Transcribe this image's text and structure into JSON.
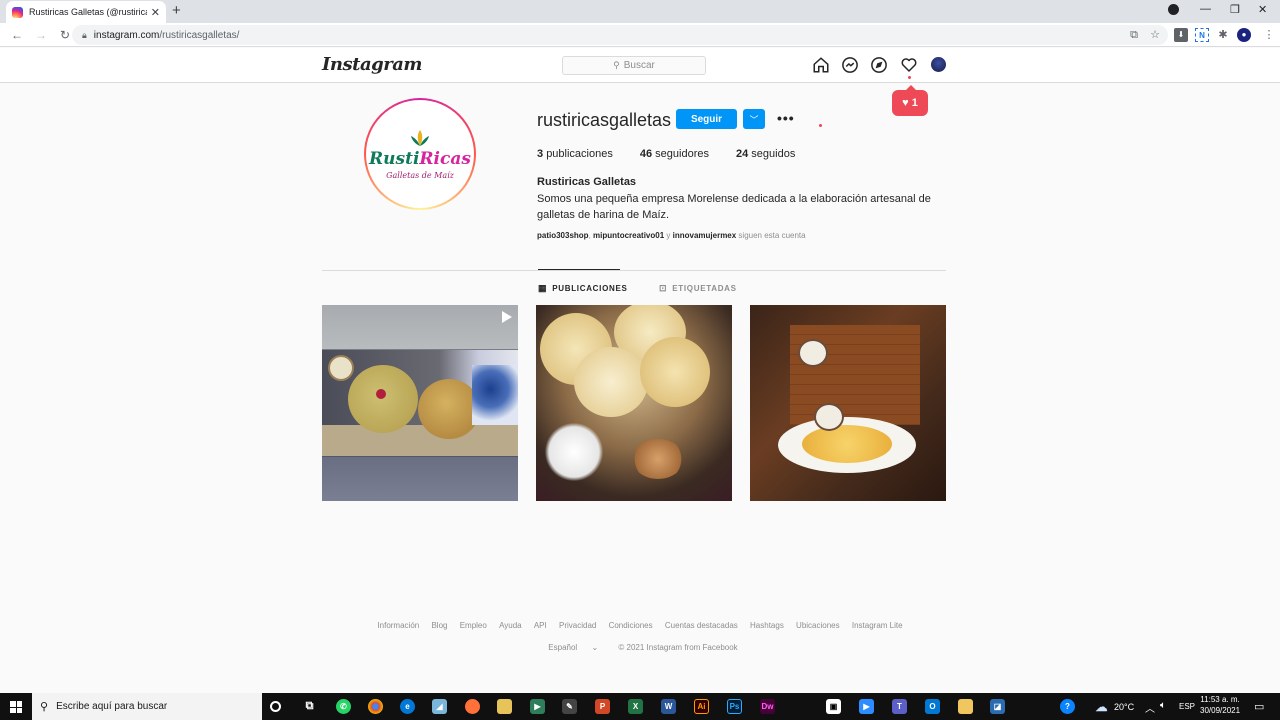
{
  "browser": {
    "tab_title": "Rustiricas Galletas (@rustiricasga",
    "tab_close": "✕",
    "new_tab": "+",
    "url_host": "instagram.com",
    "url_path": "/rustiricasgalletas/"
  },
  "instagram": {
    "logo": "Instagram",
    "search_placeholder": "Buscar",
    "notification_count": "1",
    "profile": {
      "logo_part1": "Rusti",
      "logo_part2": "Ricas",
      "logo_sub": "Galletas de Maíz",
      "username": "rustiricasgalletas",
      "follow_label": "Seguir",
      "more_label": "•••",
      "stats": {
        "posts_count": "3",
        "posts_label": "publicaciones",
        "followers_count": "46",
        "followers_label": "seguidores",
        "following_count": "24",
        "following_label": "seguidos"
      },
      "full_name": "Rustiricas Galletas",
      "bio": "Somos una pequeña empresa Morelense dedicada a la elaboración artesanal de galletas de harina de Maíz.",
      "followed_by": {
        "user1": "patio303shop",
        "sep1": ", ",
        "user2": "mipuntocreativo01",
        "sep2": " y ",
        "user3": "innovamujermex",
        "suffix": " siguen esta cuenta"
      }
    },
    "tabs": [
      {
        "label": "PUBLICACIONES",
        "icon": "grid-icon"
      },
      {
        "label": "ETIQUETADAS",
        "icon": "tag-icon"
      }
    ],
    "footer": {
      "links": [
        "Información",
        "Blog",
        "Empleo",
        "Ayuda",
        "API",
        "Privacidad",
        "Condiciones",
        "Cuentas destacadas",
        "Hashtags",
        "Ubicaciones",
        "Instagram Lite"
      ],
      "language": "Español",
      "copyright": "© 2021 Instagram from Facebook"
    }
  },
  "taskbar": {
    "search_placeholder": "Escribe aquí para buscar",
    "temperature": "20°C",
    "language": "ESP",
    "time": "11:53 a. m.",
    "date": "30/09/2021"
  }
}
